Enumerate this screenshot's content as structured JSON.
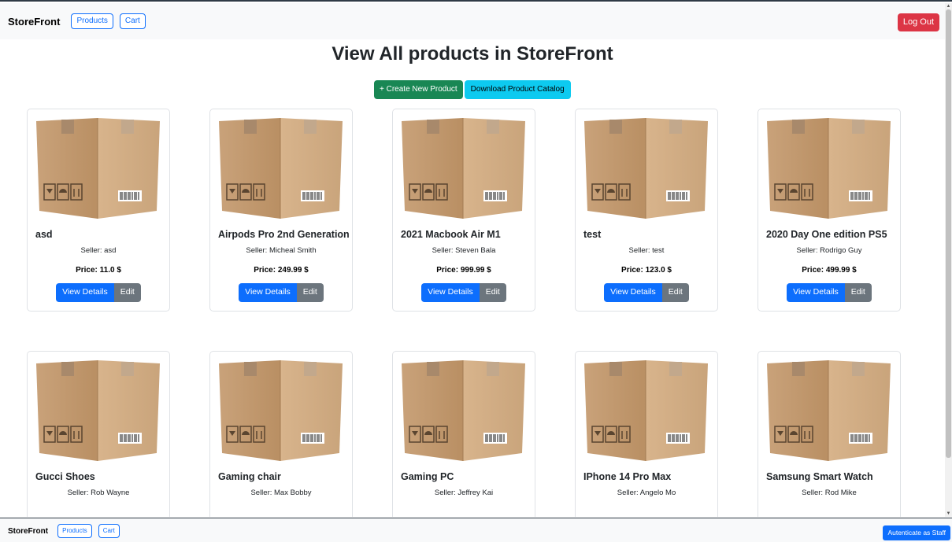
{
  "topnav": {
    "brand": "StoreFront",
    "products_label": "Products",
    "cart_label": "Cart",
    "logout_label": "Log Out",
    "logout_color": "#dc3545"
  },
  "main": {
    "title": "View All products in StoreFront",
    "create_label": "+ Create New Product",
    "download_label": "Download Product Catalog",
    "products": [
      {
        "name": "asd",
        "seller": "Seller: asd",
        "price": "Price: 11.0 $",
        "view_label": "View Details",
        "edit_label": "Edit"
      },
      {
        "name": "Airpods Pro 2nd Generation",
        "seller": "Seller: Micheal Smith",
        "price": "Price: 249.99 $",
        "view_label": "View Details",
        "edit_label": "Edit"
      },
      {
        "name": "2021 Macbook Air M1",
        "seller": "Seller: Steven Bala",
        "price": "Price: 999.99 $",
        "view_label": "View Details",
        "edit_label": "Edit"
      },
      {
        "name": "test",
        "seller": "Seller: test",
        "price": "Price: 123.0 $",
        "view_label": "View Details",
        "edit_label": "Edit"
      },
      {
        "name": "2020 Day One edition PS5",
        "seller": "Seller: Rodrigo Guy",
        "price": "Price: 499.99 $",
        "view_label": "View Details",
        "edit_label": "Edit"
      },
      {
        "name": "Gucci Shoes",
        "seller": "Seller: Rob Wayne"
      },
      {
        "name": "Gaming chair",
        "seller": "Seller: Max Bobby"
      },
      {
        "name": "Gaming PC",
        "seller": "Seller: Jeffrey Kai"
      },
      {
        "name": "IPhone 14 Pro Max",
        "seller": "Seller: Angelo Mo"
      },
      {
        "name": "Samsung Smart Watch",
        "seller": "Seller: Rod Mike"
      }
    ],
    "product_image_icon": "cardboard-box-icon"
  },
  "bottomnav": {
    "brand": "StoreFront",
    "products_label": "Products",
    "cart_label": "Cart",
    "staff_label": "Autenticate as Staff"
  },
  "colors": {
    "primary": "#0d6efd",
    "success": "#198754",
    "info": "#0dcaf0",
    "secondary": "#6c757d",
    "danger": "#dc3545"
  }
}
